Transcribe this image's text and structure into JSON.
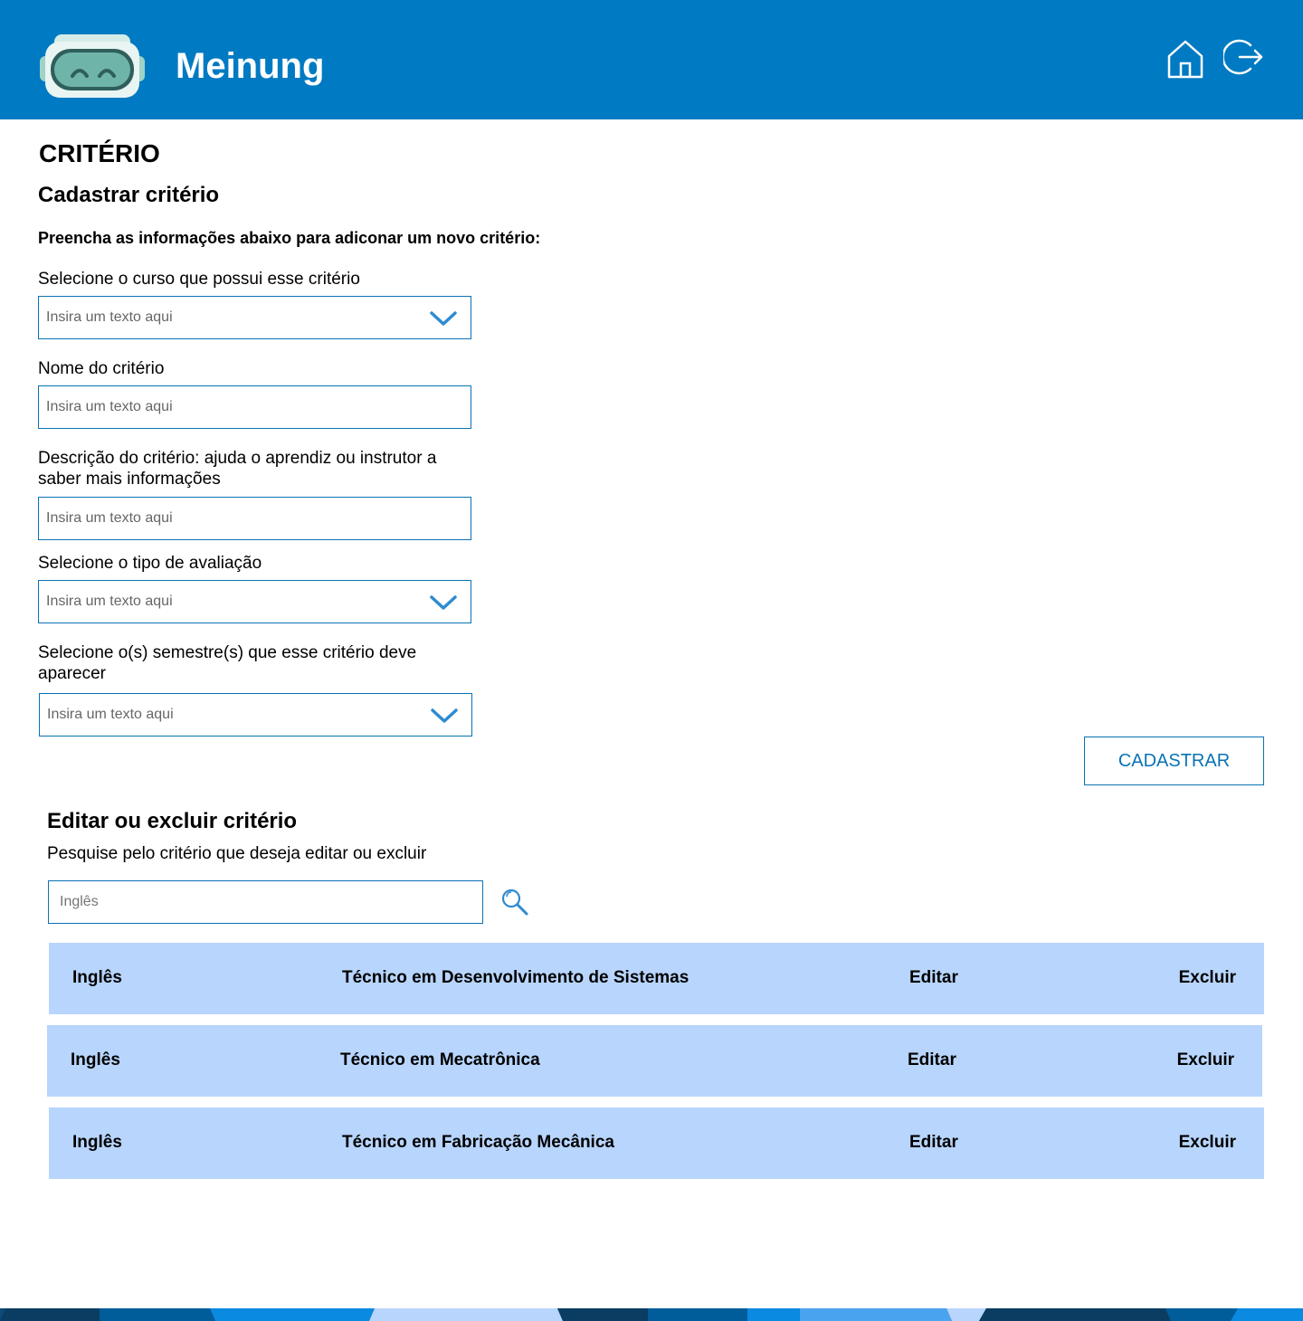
{
  "header": {
    "app_title": "Meinung",
    "icons": [
      "robot-logo",
      "home-icon",
      "logout-icon"
    ],
    "color": "#007ac2"
  },
  "page": {
    "title": "CRITÉRIO"
  },
  "register": {
    "title": "Cadastrar critério",
    "instructions": "Preencha as informações abaixo para adiconar um novo critério:",
    "course_label": "Selecione o curso que possui esse critério",
    "course_placeholder": "Insira um texto aqui",
    "name_label": "Nome do critério",
    "name_placeholder": "Insira um texto aqui",
    "description_label": "Descrição do critério: ajuda o aprendiz ou instrutor a saber mais informações",
    "description_placeholder": "Insira um texto aqui",
    "evaluation_label": "Selecione o tipo de avaliação",
    "evaluation_placeholder": "Insira um texto aqui",
    "semester_label": "Selecione o(s) semestre(s) que esse critério deve aparecer",
    "semester_placeholder": "Insira um texto aqui",
    "submit_label": "CADASTRAR"
  },
  "edit": {
    "title": "Editar ou excluir critério",
    "search_description": "Pesquise pelo critério que deseja editar ou excluir",
    "search_placeholder": "Inglês",
    "rows": [
      {
        "name": "Inglês",
        "course": "Técnico em Desenvolvimento de Sistemas",
        "edit": "Editar",
        "delete": "Excluir"
      },
      {
        "name": "Inglês",
        "course": "Técnico em Mecatrônica",
        "edit": "Editar",
        "delete": "Excluir"
      },
      {
        "name": "Inglês",
        "course": "Técnico em Fabricação Mecânica",
        "edit": "Editar",
        "delete": "Excluir"
      }
    ]
  },
  "colors": {
    "primary": "#007ac2",
    "field_border": "#0a73b5",
    "row_background": "#b8d5fd"
  }
}
